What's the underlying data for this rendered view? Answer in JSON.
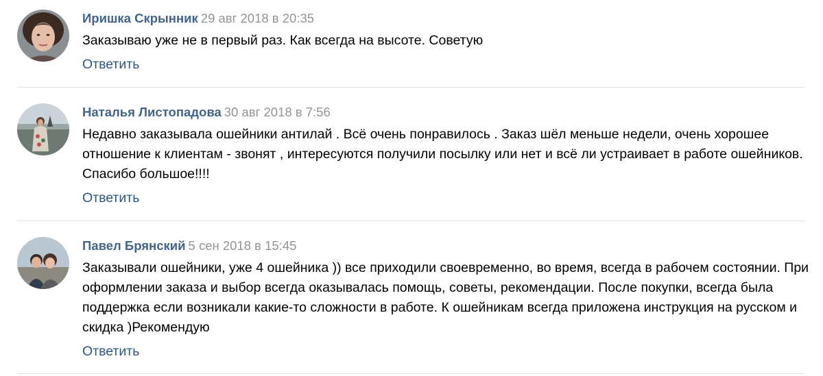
{
  "comments": [
    {
      "author": "Иришка Скрынник",
      "date": "29 авг 2018 в 20:35",
      "text": "Заказываю уже не в первый раз. Как всегда на высоте. Советую",
      "reply_label": "Ответить"
    },
    {
      "author": "Наталья Листопадова",
      "date": "30 авг 2018 в 7:56",
      "text": "Недавно заказывала ошейники антилай . Всё очень понравилось . Заказ шёл меньше недели, очень хорошее отношение к клиентам - звонят , интересуются получили посылку или нет и всё ли устраивает в работе ошейников. Спасибо большое!!!!",
      "reply_label": "Ответить"
    },
    {
      "author": "Павел Брянский",
      "date": "5 сен 2018 в 15:45",
      "text": "Заказывали ошейники, уже 4 ошейника )) все приходили своевременно, во время, всегда в рабочем состоянии. При оформлении заказа и выбор всегда оказывалась помощь, советы, рекомендации. После покупки, всегда была поддержка если возникали какие-то сложности в работе. К ошейникам всегда приложена инструкция на русском и скидка )Рекомендую",
      "reply_label": "Ответить"
    }
  ],
  "colors": {
    "author": "#42648b",
    "date": "#939393",
    "reply": "#2a5885",
    "divider": "#dfe2e6"
  }
}
